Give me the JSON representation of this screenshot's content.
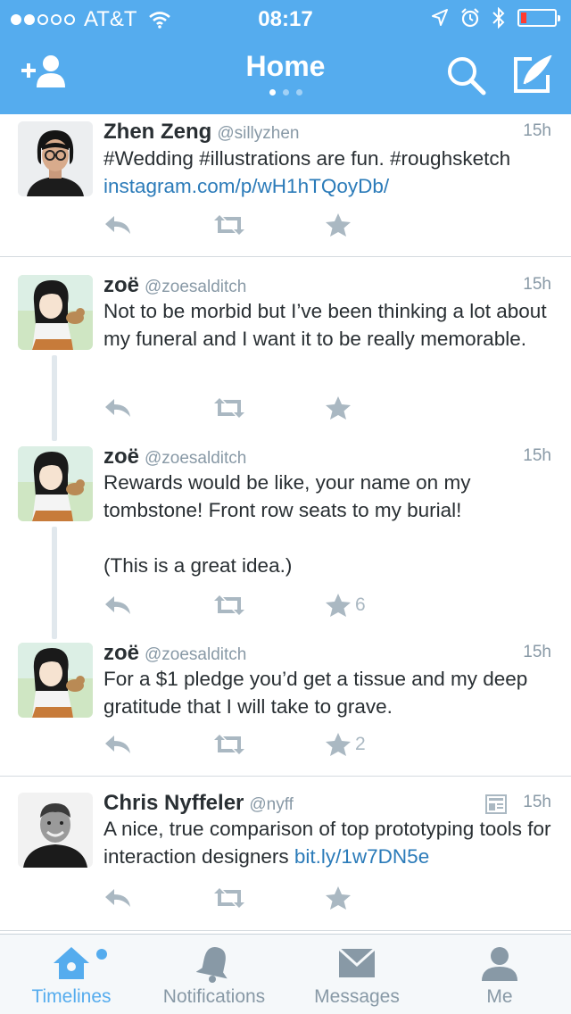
{
  "status_bar": {
    "carrier": "AT&T",
    "time": "08:17"
  },
  "header": {
    "title": "Home"
  },
  "tweets": [
    {
      "name": "Zhen Zeng",
      "handle": "@sillyzhen",
      "time": "15h",
      "text": "#Wedding #illustrations are fun. #roughsketch",
      "link": "instagram.com/p/wH1hTQoyDb/",
      "favorites": ""
    },
    {
      "name": "zoë",
      "handle": "@zoesalditch",
      "time": "15h",
      "text": "Not to be morbid but I’ve been thinking a lot about my funeral and I want it to be really memorable.",
      "favorites": ""
    },
    {
      "name": "zoë",
      "handle": "@zoesalditch",
      "time": "15h",
      "text": "Rewards would be like, your name on my tombstone! Front row seats to my burial!",
      "text2": "(This is a great idea.)",
      "favorites": "6"
    },
    {
      "name": "zoë",
      "handle": "@zoesalditch",
      "time": "15h",
      "text": "For a $1 pledge you’d get a tissue and my deep gratitude that I will take to grave.",
      "favorites": "2"
    },
    {
      "name": "Chris Nyffeler",
      "handle": "@nyff",
      "time": "15h",
      "text": "A nice, true comparison of top prototyping tools for interaction designers",
      "link": "bit.ly/1w7DN5e",
      "favorites": ""
    }
  ],
  "tabs": [
    {
      "label": "Timelines",
      "icon": "home-icon"
    },
    {
      "label": "Notifications",
      "icon": "bell-icon"
    },
    {
      "label": "Messages",
      "icon": "envelope-icon"
    },
    {
      "label": "Me",
      "icon": "person-icon"
    }
  ],
  "colors": {
    "brand": "#55acee",
    "link": "#2b7bb9",
    "muted": "#8899a6",
    "battery_low": "#ff3b30"
  }
}
